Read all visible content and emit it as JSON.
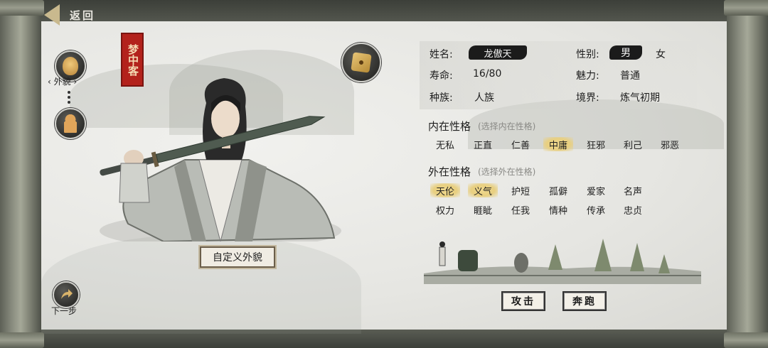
{
  "nav": {
    "back_label": "返回"
  },
  "side": {
    "appearance_label": "‹ 外貌 ›",
    "next_label": "下一步"
  },
  "seal_text": "梦中客",
  "custom_appearance_label": "自定义外貌",
  "info": {
    "name_label": "姓名:",
    "name_value": "龙傲天",
    "gender_label": "性别:",
    "gender_male": "男",
    "gender_female": "女",
    "lifespan_label": "寿命:",
    "lifespan_value": "16/80",
    "charm_label": "魅力:",
    "charm_value": "普通",
    "race_label": "种族:",
    "race_value": "人族",
    "realm_label": "境界:",
    "realm_value": "炼气初期"
  },
  "inner": {
    "title": "内在性格",
    "hint": "(选择内在性格)",
    "traits": [
      "无私",
      "正直",
      "仁善",
      "中庸",
      "狂邪",
      "利己",
      "邪恶"
    ],
    "selected": "中庸"
  },
  "outer": {
    "title": "外在性格",
    "hint": "(选择外在性格)",
    "row1": [
      "天伦",
      "义气",
      "护短",
      "孤僻",
      "爱家",
      "名声"
    ],
    "row2": [
      "权力",
      "睚眦",
      "任我",
      "情种",
      "传承",
      "忠贞"
    ],
    "selected": [
      "天伦",
      "义气"
    ]
  },
  "actions": {
    "attack_label": "攻击",
    "flee_label": "奔跑"
  },
  "icons": {
    "back": "back-arrow-icon",
    "appearance": "face-icon",
    "companion": "gourd-icon",
    "dice": "dice-icon",
    "next": "next-arrow-icon"
  },
  "colors": {
    "seal": "#b3221c",
    "highlight": "#e8cf80",
    "pill": "#1b1b1b"
  }
}
